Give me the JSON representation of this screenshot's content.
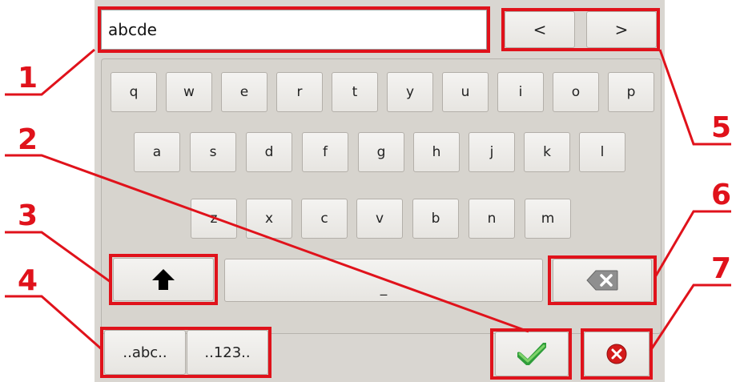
{
  "input": {
    "value": "abcde"
  },
  "nav": {
    "prev": "<",
    "next": ">"
  },
  "keys": {
    "row1": [
      "q",
      "w",
      "e",
      "r",
      "t",
      "y",
      "u",
      "i",
      "o",
      "p"
    ],
    "row2": [
      "a",
      "s",
      "d",
      "f",
      "g",
      "h",
      "j",
      "k",
      "l"
    ],
    "row3": [
      "z",
      "x",
      "c",
      "v",
      "b",
      "n",
      "m"
    ]
  },
  "space": {
    "label": "_"
  },
  "modes": {
    "abc": "..abc..",
    "num": "..123.."
  },
  "callouts": [
    "1",
    "2",
    "3",
    "4",
    "5",
    "6",
    "7"
  ],
  "colors": {
    "annotation": "#e0121b",
    "confirm": "#3bb043",
    "cancel": "#d41a1a"
  },
  "icons": {
    "shift": "shift-icon",
    "backspace": "backspace-icon",
    "confirm": "checkmark-icon",
    "cancel": "close-icon"
  }
}
